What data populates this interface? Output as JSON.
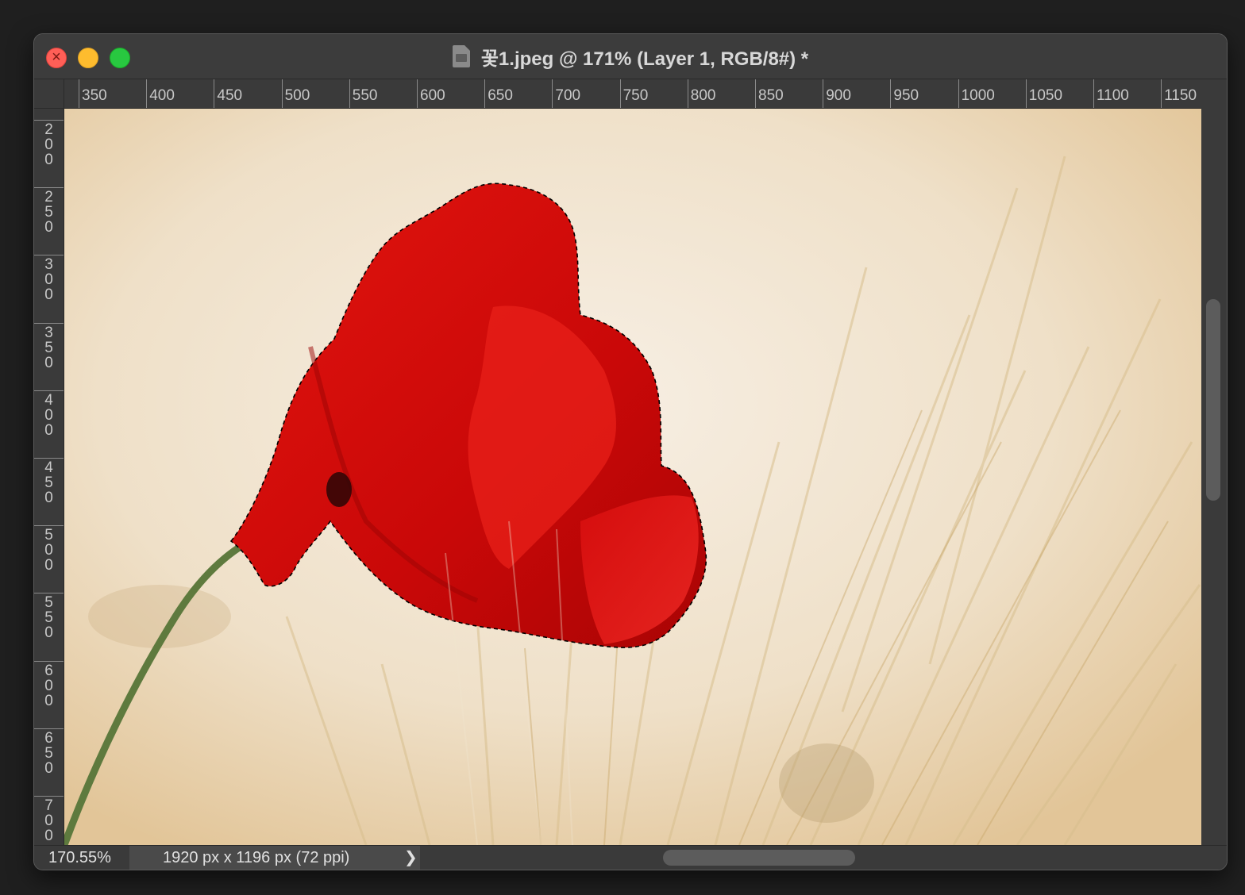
{
  "window": {
    "title": "꽃1.jpeg @ 171% (Layer 1, RGB/8#) *"
  },
  "ruler_h": [
    "350",
    "400",
    "450",
    "500",
    "550",
    "600",
    "650",
    "700",
    "750",
    "800",
    "850",
    "900",
    "950",
    "1000",
    "1050",
    "1100",
    "1150"
  ],
  "ruler_v": [
    "200",
    "250",
    "300",
    "350",
    "400",
    "450",
    "500",
    "550",
    "600",
    "650",
    "700"
  ],
  "status": {
    "zoom": "170.55%",
    "doc_info": "1920 px x 1196 px (72 ppi)",
    "chevron": "❯"
  },
  "icons": {
    "close": "close-icon",
    "minimize": "minimize-icon",
    "maximize": "maximize-icon",
    "document": "document-icon"
  },
  "colors": {
    "poppy_red": "#d40b0b",
    "stem": "#5e7a3e",
    "background": "#f1e4cf"
  }
}
